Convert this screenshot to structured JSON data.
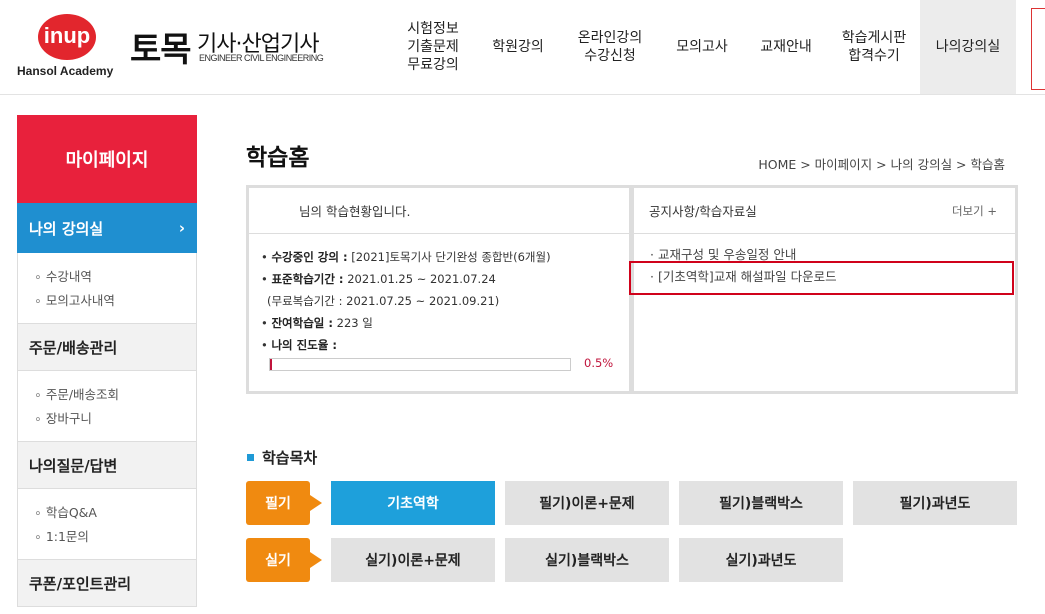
{
  "logo": {
    "mark": "inup",
    "academy": "Hansol Academy"
  },
  "brand": {
    "main": "토목",
    "sub": "기사·산업기사",
    "eng": "ENGINEER CIVIL ENGINEERING"
  },
  "gnb": [
    {
      "label": "시험정보\n기출문제\n무료강의"
    },
    {
      "label": "학원강의"
    },
    {
      "label": "온라인강의\n수강신청"
    },
    {
      "label": "모의고사"
    },
    {
      "label": "교재안내"
    },
    {
      "label": "학습게시판\n합격수기"
    },
    {
      "label": "나의강의실"
    }
  ],
  "sidebar": {
    "title": "마이페이지",
    "active": "나의 강의실",
    "active_sub": [
      "수강내역",
      "모의고사내역"
    ],
    "groups": [
      {
        "head": "주문/배송관리",
        "items": [
          "주문/배송조회",
          "장바구니"
        ]
      },
      {
        "head": "나의질문/답변",
        "items": [
          "학습Q&A",
          "1:1문의"
        ]
      },
      {
        "head": "쿠폰/포인트관리",
        "items": []
      }
    ]
  },
  "main": {
    "title": "학습홈",
    "breadcrumb": "HOME > 마이페이지 > 나의 강의실 > 학습홈",
    "status_head": "님의 학습현황입니다.",
    "course_label": "수강중인 강의 :",
    "course_value": "[2021]토목기사 단기완성 종합반(6개월)",
    "period_label": "표준학습기간 :",
    "period_value": "2021.01.25 ~ 2021.07.24",
    "review_period": "(무료복습기간 : 2021.07.25 ~ 2021.09.21)",
    "remain_label": "잔여학습일 :",
    "remain_value": "223 일",
    "progress_label": "나의 진도율 :",
    "progress_text": "0.5%",
    "progress_fraction": 0.005,
    "notice_title": "공지사항/학습자료실",
    "notice_more": "더보기 +",
    "notices": [
      "· 교재구성 및 우송일정 안내",
      "· [기초역학]교재 해설파일 다운로드"
    ]
  },
  "study": {
    "title": "학습목차",
    "written_label": "필기",
    "written": [
      "기초역학",
      "필기)이론+문제",
      "필기)블랙박스",
      "필기)과년도"
    ],
    "practical_label": "실기",
    "practical": [
      "실기)이론+문제",
      "실기)블랙박스",
      "실기)과년도"
    ]
  },
  "colors": {
    "accent": "#e8213c",
    "blue": "#1f8fd0",
    "orange": "#f08a10",
    "highlight": "#d0021b"
  }
}
